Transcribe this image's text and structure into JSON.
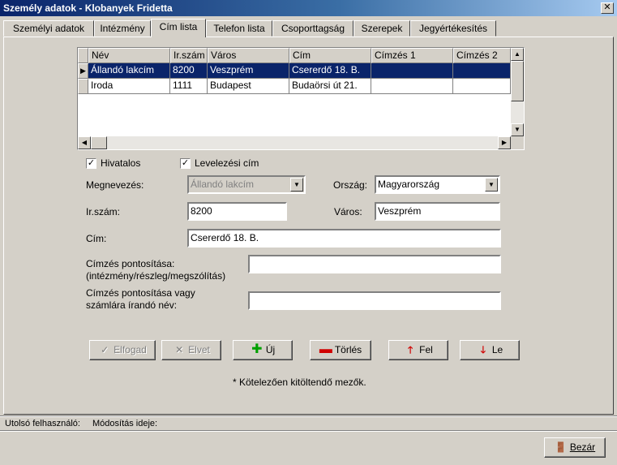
{
  "window": {
    "title": "Személy adatok - Klobanyek Fridetta"
  },
  "tabs": [
    {
      "label": "Személyi adatok"
    },
    {
      "label": "Intézmény"
    },
    {
      "label": "Cím lista"
    },
    {
      "label": "Telefon lista"
    },
    {
      "label": "Csoporttagság"
    },
    {
      "label": "Szerepek"
    },
    {
      "label": "Jegyértékesítés"
    }
  ],
  "active_tab": "Cím lista",
  "grid": {
    "headers": [
      "Név",
      "Ir.szám",
      "Város",
      "Cím",
      "Címzés 1",
      "Címzés 2"
    ],
    "rows": [
      [
        "Állandó lakcím",
        "8200",
        "Veszprém",
        "Csererdő 18. B.",
        "",
        ""
      ],
      [
        "Iroda",
        "1111",
        "Budapest",
        "Budaörsi út 21.",
        "",
        ""
      ]
    ],
    "selected_row": 0
  },
  "form": {
    "hivatalos_label": "Hivatalos",
    "hivatalos_checked": true,
    "levelezesi_label": "Levelezési cím",
    "levelezesi_checked": true,
    "megnevezes_label": "Megnevezés:",
    "megnevezes_value": "Állandó lakcím",
    "orszag_label": "Ország:",
    "orszag_value": "Magyarország",
    "irszam_label": "Ir.szám:",
    "irszam_value": "8200",
    "varos_label": "Város:",
    "varos_value": "Veszprém",
    "cim_label": "Cím:",
    "cim_value": "Csererdő 18. B.",
    "pontositas_label_1": "Címzés pontosítása:",
    "pontositas_label_2": "(intézmény/részleg/megszólítás)",
    "pontositas_value": "",
    "szamlara_label_1": "Címzés pontosítása vagy",
    "szamlara_label_2": "számlára írandó név:",
    "szamlara_value": ""
  },
  "buttons": {
    "elfogad": "Elfogad",
    "elvet": "Elvet",
    "uj": "Új",
    "torles": "Törlés",
    "fel": "Fel",
    "le": "Le",
    "bezar": "Bezár"
  },
  "note": "* Kötelezően kitöltendő mezők.",
  "status": {
    "last_user_label": "Utolsó felhasználó:",
    "modified_label": "Módosítás ideje:"
  },
  "icons": {
    "elfogad": "checkmark-icon",
    "elvet": "x-icon",
    "uj": "plus-icon",
    "torles": "minus-icon",
    "fel": "arrow-up-icon",
    "le": "arrow-down-icon",
    "bezar": "door-exit-icon"
  },
  "colors": {
    "selection": "#0a246a",
    "plus": "#00a000",
    "minus": "#d00000",
    "arrow": "#d00000"
  }
}
